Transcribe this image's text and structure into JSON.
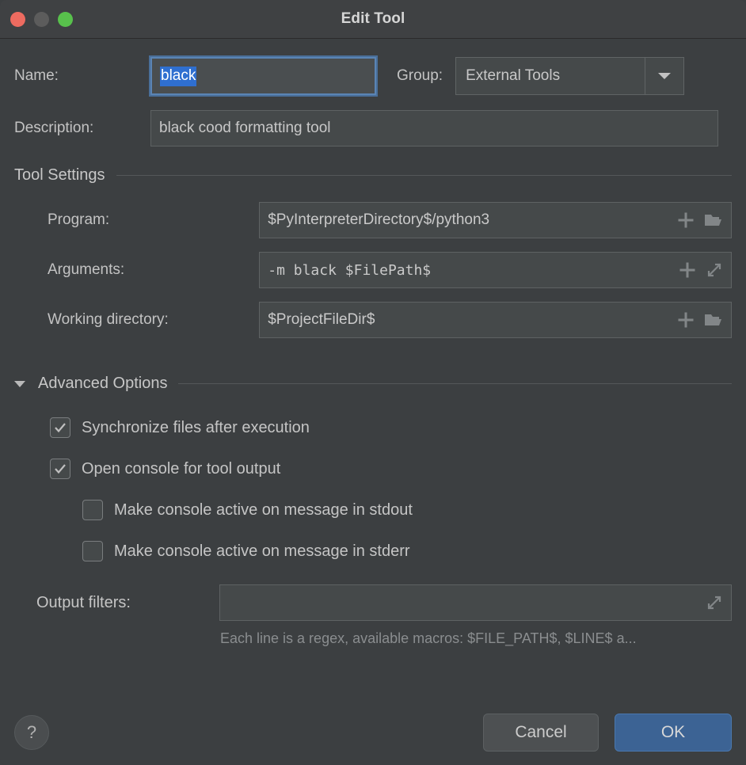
{
  "window": {
    "title": "Edit Tool",
    "traffic_lights": [
      {
        "name": "close",
        "color": "#ed6b60"
      },
      {
        "name": "minimize",
        "color": "#5c5c5c"
      },
      {
        "name": "zoom",
        "color": "#58c14c"
      }
    ]
  },
  "form": {
    "name_label": "Name:",
    "name_value": "black",
    "name_selected": true,
    "group_label": "Group:",
    "group_value": "External Tools",
    "description_label": "Description:",
    "description_value": "black cood formatting tool"
  },
  "tool_settings": {
    "section_title": "Tool Settings",
    "rows": [
      {
        "label": "Program:",
        "value": "$PyInterpreterDirectory$/python3",
        "mono": false,
        "actions": [
          "insert-macro-icon",
          "browse-folder-icon"
        ]
      },
      {
        "label": "Arguments:",
        "value": "-m black $FilePath$",
        "mono": true,
        "actions": [
          "insert-macro-icon",
          "expand-editor-icon"
        ]
      },
      {
        "label": "Working directory:",
        "value": "$ProjectFileDir$",
        "mono": false,
        "actions": [
          "insert-macro-icon",
          "browse-folder-icon"
        ]
      }
    ]
  },
  "advanced_options": {
    "section_title": "Advanced Options",
    "expanded": true,
    "checkboxes": [
      {
        "label": "Synchronize files after execution",
        "checked": true,
        "indent": false
      },
      {
        "label": "Open console for tool output",
        "checked": true,
        "indent": false
      },
      {
        "label": "Make console active on message in stdout",
        "checked": false,
        "indent": true
      },
      {
        "label": "Make console active on message in stderr",
        "checked": false,
        "indent": true
      }
    ],
    "output_filters_label": "Output filters:",
    "output_filters_value": "",
    "output_filters_hint": "Each line is a regex, available macros: $FILE_PATH$, $LINE$ a..."
  },
  "footer": {
    "help_label": "?",
    "cancel_label": "Cancel",
    "ok_label": "OK",
    "ok_color": "#3c6394"
  }
}
